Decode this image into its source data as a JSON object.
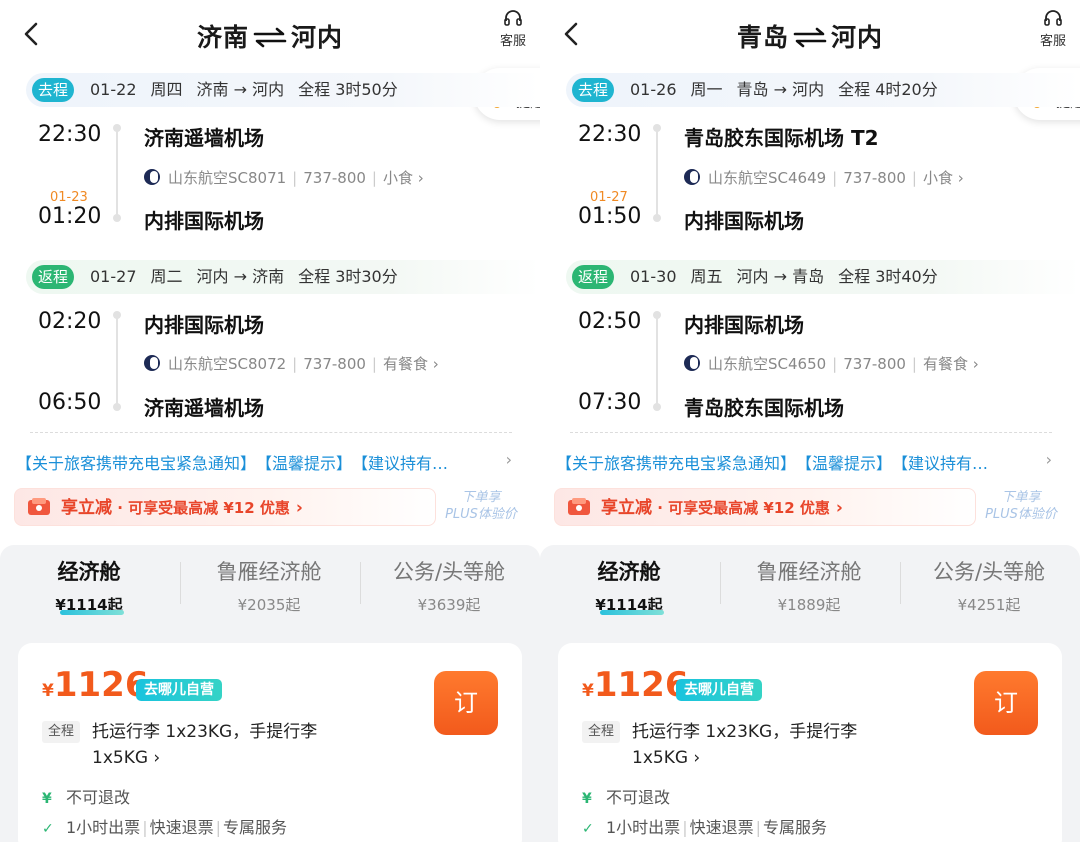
{
  "panels": [
    {
      "header": {
        "from": "济南",
        "to": "河内",
        "service_label": "客服"
      },
      "price_alert": {
        "line1": "降价",
        "line2": "提醒"
      },
      "outbound": {
        "tag": "去程",
        "date": "01-22",
        "weekday": "周四",
        "route": "济南 → 河内",
        "duration": "全程 3时50分",
        "dep_time": "22:30",
        "dep_airport": "济南遥墙机场",
        "airline": "山东航空SC8071",
        "aircraft": "737-800",
        "meal": "小食",
        "arr_next_day": "01-23",
        "arr_time": "01:20",
        "arr_airport": "内排国际机场"
      },
      "return": {
        "tag": "返程",
        "date": "01-27",
        "weekday": "周二",
        "route": "河内 → 济南",
        "duration": "全程 3时30分",
        "dep_time": "02:20",
        "dep_airport": "内排国际机场",
        "airline": "山东航空SC8072",
        "aircraft": "737-800",
        "meal": "有餐食",
        "arr_time": "06:50",
        "arr_airport": "济南遥墙机场"
      },
      "notices": [
        "【关于旅客携带充电宝紧急通知】",
        "【温馨提示】",
        "【建议持有…"
      ],
      "promo": {
        "title": "享立减",
        "sub": " · 可享受最高减 ¥12 优惠",
        "plus_line1": "下单享",
        "plus_line2": "PLUS体验价"
      },
      "cabins": [
        {
          "name": "经济舱",
          "price": "¥1114起"
        },
        {
          "name": "鲁雁经济舱",
          "price": "¥2035起"
        },
        {
          "name": "公务/头等舱",
          "price": "¥3639起"
        }
      ],
      "offer": {
        "currency": "¥",
        "price": "1126",
        "badge": "去哪儿自营",
        "book": "订",
        "full_tag": "全程",
        "luggage": "托运行李 1x23KG，手提行李 1x5KG ›",
        "refund": "不可退改",
        "service1": "1小时出票",
        "service2": "快速退票",
        "service3": "专属服务"
      }
    },
    {
      "header": {
        "from": "青岛",
        "to": "河内",
        "service_label": "客服"
      },
      "price_alert": {
        "line1": "降价",
        "line2": "提醒"
      },
      "outbound": {
        "tag": "去程",
        "date": "01-26",
        "weekday": "周一",
        "route": "青岛 → 河内",
        "duration": "全程 4时20分",
        "dep_time": "22:30",
        "dep_airport": "青岛胶东国际机场 T2",
        "airline": "山东航空SC4649",
        "aircraft": "737-800",
        "meal": "小食",
        "arr_next_day": "01-27",
        "arr_time": "01:50",
        "arr_airport": "内排国际机场"
      },
      "return": {
        "tag": "返程",
        "date": "01-30",
        "weekday": "周五",
        "route": "河内 → 青岛",
        "duration": "全程 3时40分",
        "dep_time": "02:50",
        "dep_airport": "内排国际机场",
        "airline": "山东航空SC4650",
        "aircraft": "737-800",
        "meal": "有餐食",
        "arr_time": "07:30",
        "arr_airport": "青岛胶东国际机场"
      },
      "notices": [
        "【关于旅客携带充电宝紧急通知】",
        "【温馨提示】",
        "【建议持有…"
      ],
      "promo": {
        "title": "享立减",
        "sub": " · 可享受最高减 ¥12 优惠",
        "plus_line1": "下单享",
        "plus_line2": "PLUS体验价"
      },
      "cabins": [
        {
          "name": "经济舱",
          "price": "¥1114起"
        },
        {
          "name": "鲁雁经济舱",
          "price": "¥1889起"
        },
        {
          "name": "公务/头等舱",
          "price": "¥4251起"
        }
      ],
      "offer": {
        "currency": "¥",
        "price": "1126",
        "badge": "去哪儿自营",
        "book": "订",
        "full_tag": "全程",
        "luggage": "托运行李 1x23KG，手提行李 1x5KG ›",
        "refund": "不可退改",
        "service1": "1小时出票",
        "service2": "快速退票",
        "service3": "专属服务"
      }
    }
  ]
}
